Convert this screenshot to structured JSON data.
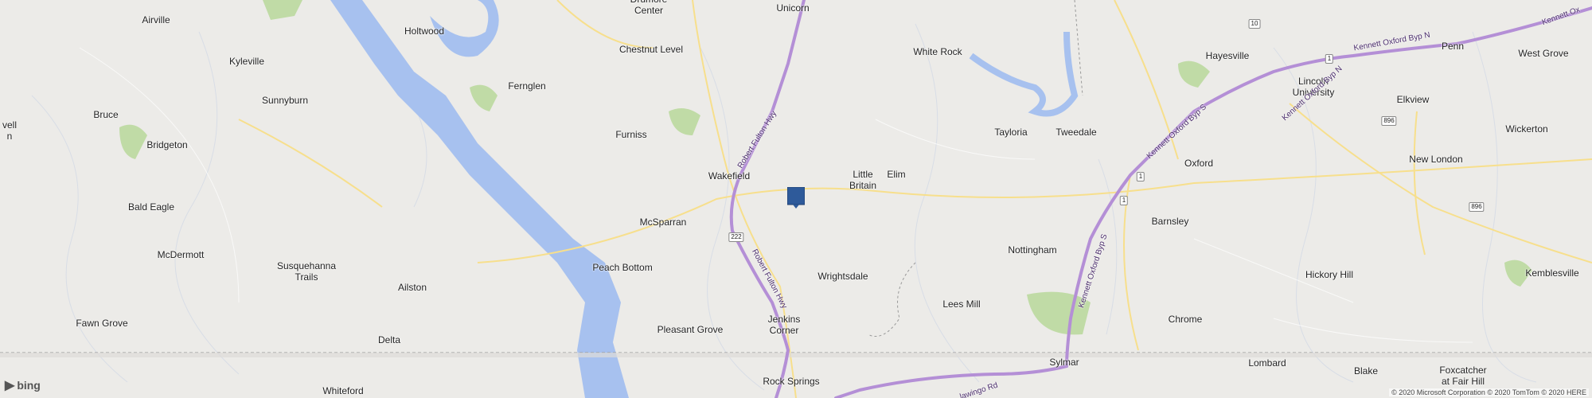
{
  "map": {
    "branding": "bing",
    "copyright": "© 2020 Microsoft Corporation © 2020 TomTom © 2020 HERE",
    "places": [
      {
        "name": "Airville"
      },
      {
        "name": "Holtwood"
      },
      {
        "name": "Drumore\nCenter"
      },
      {
        "name": "Unicorn"
      },
      {
        "name": "Chestnut Level"
      },
      {
        "name": "White Rock"
      },
      {
        "name": "Hayesville"
      },
      {
        "name": "Penn"
      },
      {
        "name": "West Grove"
      },
      {
        "name": "Kyleville"
      },
      {
        "name": "Fernglen"
      },
      {
        "name": "Sunnyburn"
      },
      {
        "name": "Lincoln\nUniversity"
      },
      {
        "name": "Elkview"
      },
      {
        "name": "Bruce"
      },
      {
        "name": "well"
      },
      {
        "name": "Bridgeton"
      },
      {
        "name": "Furniss"
      },
      {
        "name": "Tayloria"
      },
      {
        "name": "Tweedale"
      },
      {
        "name": "Wickerton"
      },
      {
        "name": "Wakefield"
      },
      {
        "name": "Little\nBritain"
      },
      {
        "name": "Elim"
      },
      {
        "name": "Oxford"
      },
      {
        "name": "New London"
      },
      {
        "name": "Bald Eagle"
      },
      {
        "name": "McSparran"
      },
      {
        "name": "Barnsley"
      },
      {
        "name": "McDermott"
      },
      {
        "name": "Nottingham"
      },
      {
        "name": "Susquehanna\nTrails"
      },
      {
        "name": "Peach Bottom"
      },
      {
        "name": "Wrightsdale"
      },
      {
        "name": "Hickory Hill"
      },
      {
        "name": "Kemblesville"
      },
      {
        "name": "Ailston"
      },
      {
        "name": "Lees Mill"
      },
      {
        "name": "Fawn Grove"
      },
      {
        "name": "Pleasant Grove"
      },
      {
        "name": "Jenkins\nCorner"
      },
      {
        "name": "Chrome"
      },
      {
        "name": "Delta"
      },
      {
        "name": "Sylmar"
      },
      {
        "name": "Lombard"
      },
      {
        "name": "Blake"
      },
      {
        "name": "Foxcatcher\nat Fair Hill"
      },
      {
        "name": "Whiteford"
      },
      {
        "name": "Rock Springs"
      }
    ],
    "road_labels": [
      {
        "text": "Kennett Oxford Byp N"
      },
      {
        "text": "Kennett Oxford Byp N"
      },
      {
        "text": "Kennett Oxford Byp S"
      },
      {
        "text": "Kennett Oxford Byp S"
      },
      {
        "text": "Robert Fulton Hwy"
      },
      {
        "text": "Robert Fulton Hwy"
      },
      {
        "text": "Kennett Oxford Byp S"
      },
      {
        "text": "Kennett Ox"
      },
      {
        "text": "lawingo Rd"
      }
    ],
    "shields": [
      {
        "text": "10"
      },
      {
        "text": "1"
      },
      {
        "text": "1"
      },
      {
        "text": "1"
      },
      {
        "text": "896"
      },
      {
        "text": "896"
      },
      {
        "text": "222"
      }
    ],
    "colors": {
      "water": "#a7c1ef",
      "land": "#ecebe8",
      "park": "#b9d89a",
      "highway": "#b48fd6",
      "road": "#f7df8c"
    }
  }
}
